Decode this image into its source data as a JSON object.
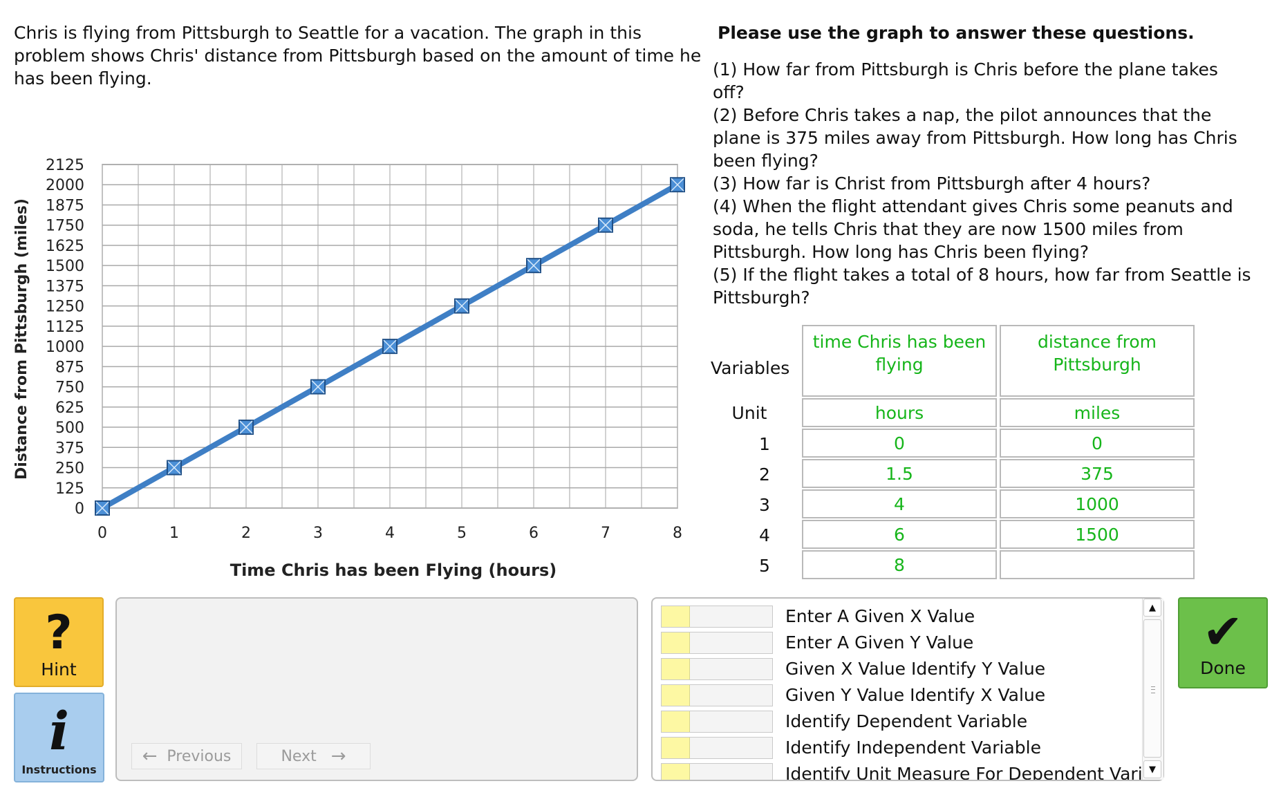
{
  "problem": {
    "text": "Chris is flying from Pittsburgh to Seattle for a vacation. The graph in this problem shows Chris' distance from Pittsburgh based on the amount of time he has been flying."
  },
  "questions": {
    "heading": "Please use the graph to answer these questions.",
    "items": [
      "(1) How far from Pittsburgh is Chris before the plane takes off?",
      "(2) Before Chris takes a nap, the pilot announces that the plane is 375 miles away from Pittsburgh. How long has Chris been flying?",
      "(3) How far is Christ from Pittsburgh after 4 hours?",
      "(4) When the flight attendant gives Chris some peanuts and soda, he tells Chris that they are now 1500 miles from Pittsburgh. How long has Chris been flying?",
      "(5) If the flight takes a total of 8 hours, how far from Seattle is Pittsburgh?"
    ]
  },
  "chart_data": {
    "type": "line",
    "x": [
      0,
      1,
      2,
      3,
      4,
      5,
      6,
      7,
      8
    ],
    "series": [
      {
        "values": [
          0,
          250,
          500,
          750,
          1000,
          1250,
          1500,
          1750,
          2000
        ]
      }
    ],
    "xlabel": "Time Chris has been Flying (hours)",
    "ylabel": "Distance from Pittsburgh (miles)",
    "xlim": [
      0,
      8
    ],
    "ylim": [
      0,
      2125
    ],
    "xticks": [
      "0",
      "1",
      "2",
      "3",
      "4",
      "5",
      "6",
      "7",
      "8"
    ],
    "yticks": [
      "0",
      "125",
      "250",
      "375",
      "500",
      "625",
      "750",
      "875",
      "1000",
      "1125",
      "1250",
      "1375",
      "1500",
      "1625",
      "1750",
      "1875",
      "2000",
      "2125"
    ],
    "x_minor_step": 0.5,
    "grid": true,
    "line_color": "#3f7fc5",
    "marker": "square",
    "marker_color": "#4b8fd6"
  },
  "table": {
    "variables_label": "Variables",
    "unit_label": "Unit",
    "headers": [
      "time Chris has been flying",
      "distance from Pittsburgh"
    ],
    "units": [
      "hours",
      "miles"
    ],
    "rows": [
      {
        "num": "1",
        "x": "0",
        "y": "0"
      },
      {
        "num": "2",
        "x": "1.5",
        "y": "375"
      },
      {
        "num": "3",
        "x": "4",
        "y": "1000"
      },
      {
        "num": "4",
        "x": "6",
        "y": "1500"
      },
      {
        "num": "5",
        "x": "8",
        "y": ""
      }
    ],
    "text_color": "#16b51a"
  },
  "buttons": {
    "hint_glyph": "?",
    "hint": "Hint",
    "instructions_glyph": "i",
    "instructions": "Instructions",
    "previous": "Previous",
    "next": "Next",
    "done_glyph": "✔",
    "done": "Done"
  },
  "skills": [
    "Enter A Given X Value",
    "Enter A Given Y Value",
    "Given X Value Identify Y Value",
    "Given Y Value Identify X Value",
    "Identify Dependent Variable",
    "Identify Independent Variable",
    "Identify Unit Measure For Dependent Variable"
  ],
  "colors": {
    "hint_bg": "#f9c63d",
    "instructions_bg": "#a9cdee",
    "done_bg": "#6cc04a",
    "skill_fill": "#fdf8a3"
  }
}
